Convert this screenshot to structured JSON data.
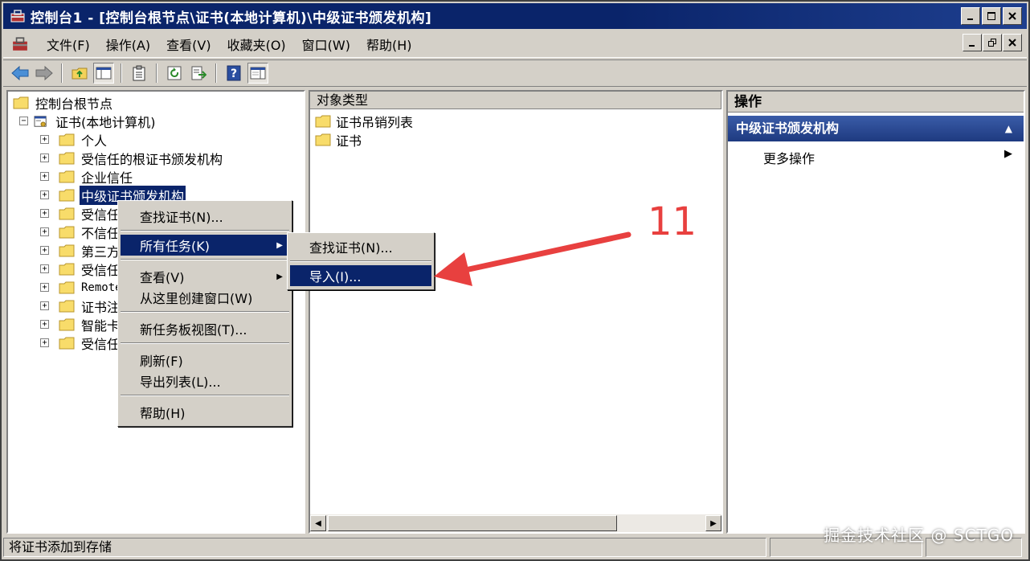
{
  "window": {
    "title": "控制台1 - [控制台根节点\\证书(本地计算机)\\中级证书颁发机构]"
  },
  "menubar": {
    "items": [
      "文件(F)",
      "操作(A)",
      "查看(V)",
      "收藏夹(O)",
      "窗口(W)",
      "帮助(H)"
    ]
  },
  "tree": {
    "root": "控制台根节点",
    "cert_node": "证书(本地计算机)",
    "children": [
      {
        "label": "个人"
      },
      {
        "label": "受信任的根证书颁发机构"
      },
      {
        "label": "企业信任"
      },
      {
        "label": "中级证书颁发机构"
      },
      {
        "label": "受信任"
      },
      {
        "label": "不信任"
      },
      {
        "label": "第三方"
      },
      {
        "label": "受信任"
      },
      {
        "label": "Remote"
      },
      {
        "label": "证书注"
      },
      {
        "label": "智能卡"
      },
      {
        "label": "受信任"
      }
    ]
  },
  "list": {
    "column_header": "对象类型",
    "items": [
      "证书吊销列表",
      "证书"
    ]
  },
  "actions": {
    "header": "操作",
    "section": "中级证书颁发机构",
    "more": "更多操作"
  },
  "context_menu": {
    "items": [
      "查找证书(N)...",
      "所有任务(K)",
      "查看(V)",
      "从这里创建窗口(W)",
      "新任务板视图(T)...",
      "刷新(F)",
      "导出列表(L)...",
      "帮助(H)"
    ]
  },
  "submenu": {
    "items": [
      "查找证书(N)...",
      "导入(I)..."
    ]
  },
  "statusbar": {
    "text": "将证书添加到存储"
  },
  "annotation": {
    "number": "11",
    "color": "#e8403f"
  },
  "watermark": "掘金技术社区 @ SCTGO",
  "colors": {
    "selection": "#0a246a",
    "chrome": "#d4d0c8",
    "annotation": "#e8403f"
  }
}
